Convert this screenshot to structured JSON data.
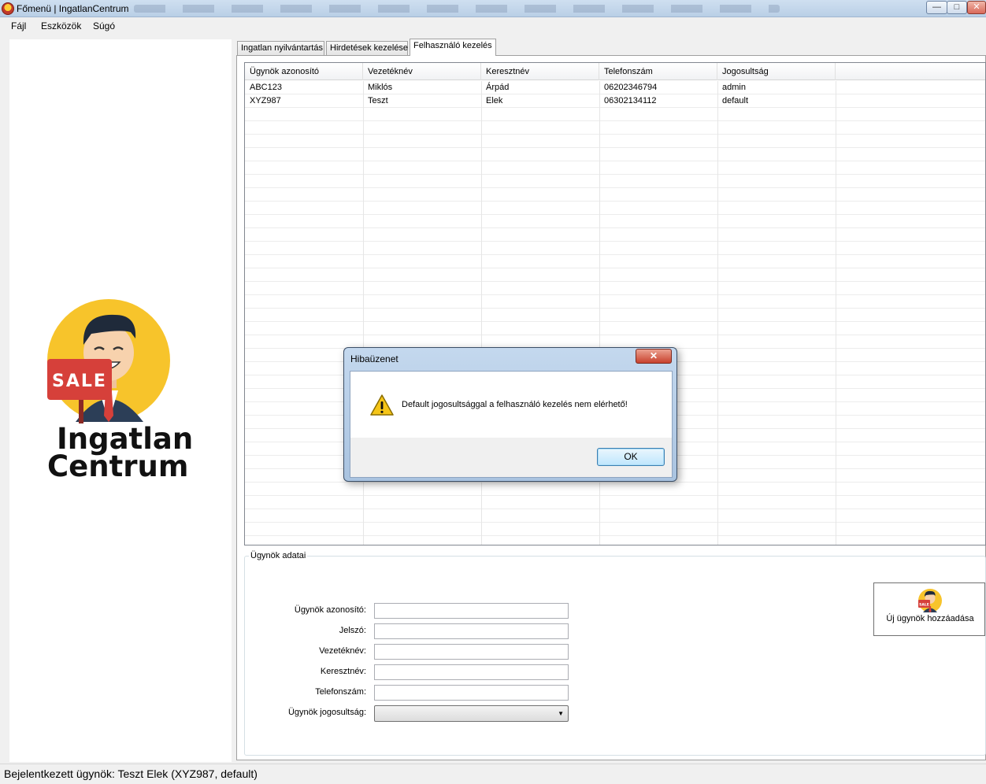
{
  "window": {
    "title": "Főmenü | IngatlanCentrum",
    "controls": {
      "minimize": "—",
      "maximize": "□",
      "close": "✕"
    }
  },
  "menu": [
    "Fájl",
    "Eszközök",
    "Súgó"
  ],
  "logo": {
    "line1": "Ingatlan",
    "line2": "Centrum",
    "sign": "SALE"
  },
  "tabs": [
    "Ingatlan nyilvántartás",
    "Hirdetések kezelése",
    "Felhasználó kezelés"
  ],
  "active_tab": "Felhasználó kezelés",
  "grid": {
    "columns": [
      "Ügynök azonosító",
      "Vezetéknév",
      "Keresztnév",
      "Telefonszám",
      "Jogosultság"
    ],
    "rows": [
      [
        "ABC123",
        "Miklós",
        "Árpád",
        "06202346794",
        "admin"
      ],
      [
        "XYZ987",
        "Teszt",
        "Elek",
        "06302134112",
        "default"
      ]
    ]
  },
  "form": {
    "group_title": "Ügynök adatai",
    "fields": [
      "Ügynök azonosító:",
      "Jelszó:",
      "Vezetéknév:",
      "Keresztnév:",
      "Telefonszám:",
      "Ügynök jogosultság:"
    ],
    "values": [
      "",
      "",
      "",
      "",
      "",
      ""
    ],
    "add_button": "Új ügynök hozzáadása"
  },
  "status": "Bejelentkezett ügynök: Teszt Elek (XYZ987, default)",
  "dialog": {
    "title": "Hibaüzenet",
    "message": "Default jogosultsággal a felhasználó kezelés nem elérhető!",
    "ok": "OK",
    "close": "✕"
  },
  "colors": {
    "dialog_frame": "#a9c3e0",
    "ok_button": "#bee6fd",
    "close_button": "#c8412d",
    "logo_yellow": "#f7c42b",
    "logo_red": "#d6403a"
  }
}
